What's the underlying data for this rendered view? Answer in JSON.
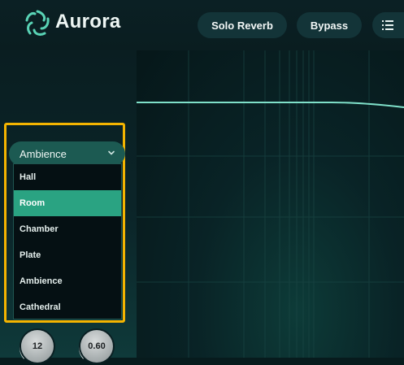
{
  "app": {
    "name": "Aurora"
  },
  "toolbar": {
    "solo_label": "Solo Reverb",
    "bypass_label": "Bypass"
  },
  "reverb_type": {
    "selected": "Ambience",
    "highlighted": "Room",
    "options": [
      "Hall",
      "Room",
      "Chamber",
      "Plate",
      "Ambience",
      "Cathedral"
    ]
  },
  "knobs": [
    {
      "value": "12"
    },
    {
      "value": "0.60"
    }
  ],
  "colors": {
    "accent": "#2aa382",
    "focus": "#f4b400",
    "curve": "#7fe0c9"
  },
  "icons": {
    "logo": "aurora-logo-icon",
    "menu": "list-menu-icon",
    "chevron": "chevron-down-icon"
  }
}
